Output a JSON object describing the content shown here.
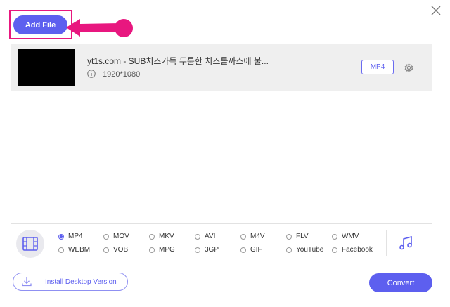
{
  "toolbar": {
    "add_file_label": "Add File"
  },
  "file": {
    "name": "yt1s.com - SUB치즈가득 두툼한 치즈롤까스에 불...",
    "resolution": "1920*1080",
    "format": "MP4"
  },
  "formats": {
    "row1": [
      "MP4",
      "MOV",
      "MKV",
      "AVI",
      "M4V",
      "FLV",
      "WMV"
    ],
    "row2": [
      "WEBM",
      "VOB",
      "MPG",
      "3GP",
      "GIF",
      "YouTube",
      "Facebook"
    ],
    "selected": "MP4"
  },
  "footer": {
    "install_label": "Install Desktop Version",
    "convert_label": "Convert"
  },
  "colors": {
    "accent": "#5d5fef",
    "highlight": "#e8177f",
    "row_bg": "#efefef"
  }
}
